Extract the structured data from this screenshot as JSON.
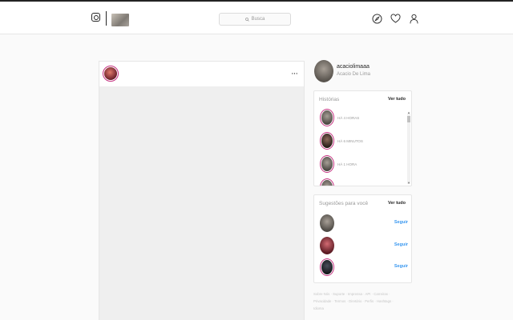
{
  "header": {
    "search_placeholder": "Busca"
  },
  "feed": {
    "more_label": "···"
  },
  "profile": {
    "username": "acaciolimaaa",
    "full_name": "Acacio De Lima"
  },
  "stories": {
    "title": "Histórias",
    "see_all": "Ver tudo",
    "items": [
      {
        "time": "HÁ 4 HORAS"
      },
      {
        "time": "HÁ 6 MINUTOS"
      },
      {
        "time": "HÁ 1 HORA"
      }
    ]
  },
  "suggestions": {
    "title": "Sugestões para você",
    "see_all": "Ver tudo",
    "follow_label": "Seguir"
  },
  "footer": {
    "line1": "Sobre Nós · Suporte · Imprensa · API · Carreiras ·",
    "line2": "Privacidade · Termos · Diretório · Perfis · Hashtags ·",
    "line3": "Idioma"
  },
  "colors": {
    "link_blue": "#3897f0",
    "story_ring": "#c4307f"
  },
  "icons": [
    "instagram-logo-icon",
    "search-icon",
    "explore-compass-icon",
    "heart-icon",
    "profile-icon",
    "more-options-icon"
  ]
}
